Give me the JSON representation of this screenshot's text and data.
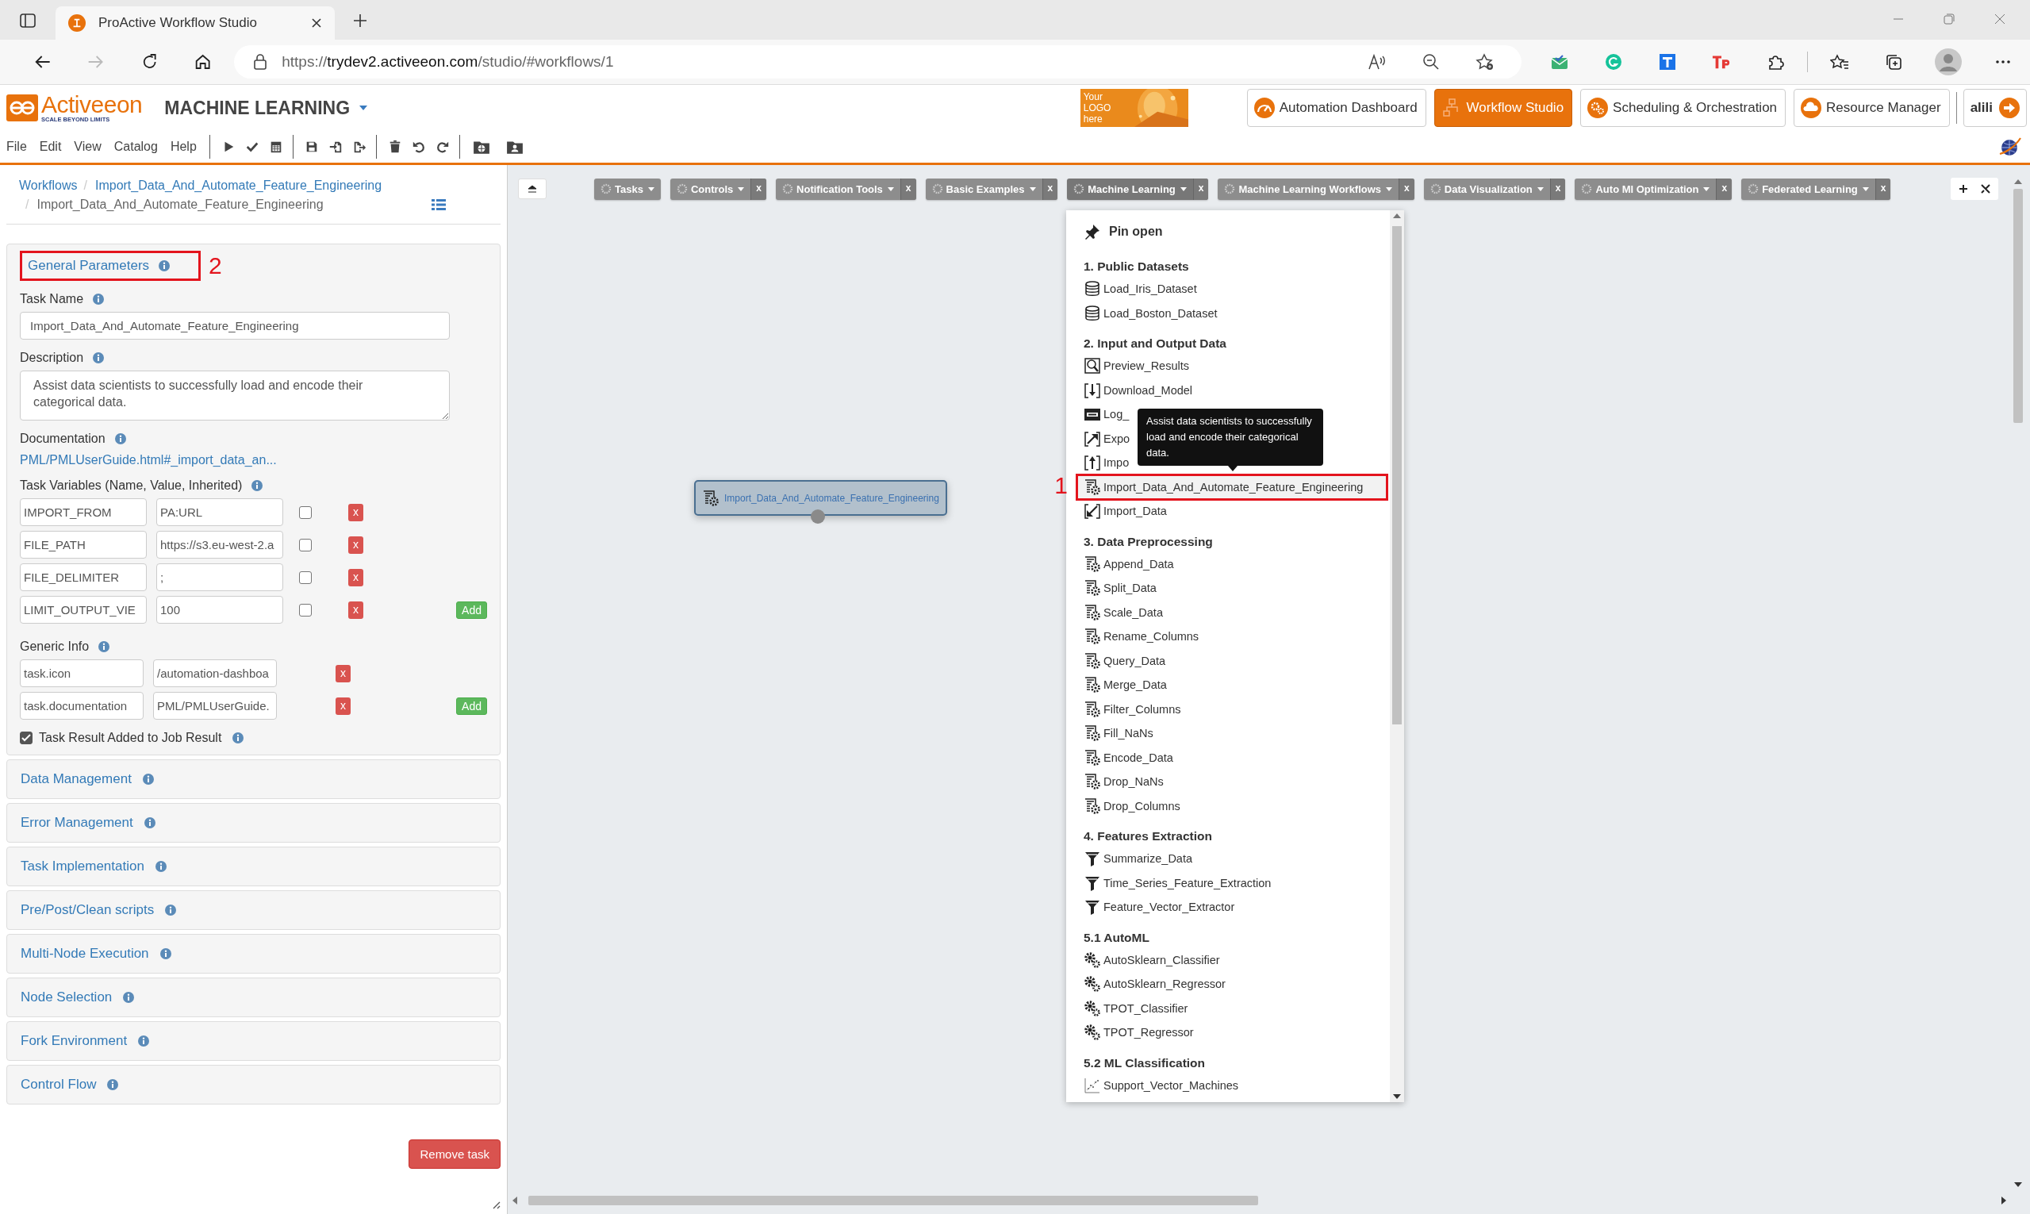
{
  "browser": {
    "tab_title": "ProActive Workflow Studio",
    "url": {
      "scheme": "https://",
      "host": "trydev2.activeeon.com",
      "path": "/studio/#workflows/1"
    }
  },
  "header": {
    "logo": "Activeeon",
    "tagline": "SCALE BEYOND LIMITS",
    "workspace": "MACHINE LEARNING",
    "logo_placeholder": "Your LOGO here",
    "portals": [
      {
        "label": "Automation Dashboard",
        "selected": false
      },
      {
        "label": "Workflow Studio",
        "selected": true
      },
      {
        "label": "Scheduling & Orchestration",
        "selected": false
      },
      {
        "label": "Resource Manager",
        "selected": false
      }
    ],
    "user": "alili"
  },
  "menu": [
    "File",
    "Edit",
    "View",
    "Catalog",
    "Help"
  ],
  "breadcrumb": [
    {
      "label": "Workflows",
      "link": true
    },
    {
      "sep": "/",
      "label": "Import_Data_And_Automate_Feature_Engineering",
      "link": true
    },
    {
      "sep": "/",
      "label": "Import_Data_And_Automate_Feature_Engineering",
      "link": false
    }
  ],
  "properties": {
    "general": {
      "title": "General Parameters",
      "callout": "2",
      "task_name_label": "Task Name",
      "task_name": "Import_Data_And_Automate_Feature_Engineering",
      "description_label": "Description",
      "description": "Assist data scientists to successfully load and encode their categorical data.",
      "documentation_label": "Documentation",
      "documentation": "PML/PMLUserGuide.html#_import_data_an...",
      "variables_label": "Task Variables (Name, Value, Inherited)",
      "variables": [
        {
          "name": "IMPORT_FROM",
          "value": "PA:URL",
          "inherited": false,
          "remove": "x"
        },
        {
          "name": "FILE_PATH",
          "value": "https://s3.eu-west-2.a",
          "inherited": false,
          "remove": "x"
        },
        {
          "name": "FILE_DELIMITER",
          "value": ";",
          "inherited": false,
          "remove": "x"
        },
        {
          "name": "LIMIT_OUTPUT_VIE",
          "value": "100",
          "inherited": false,
          "remove": "x"
        }
      ],
      "variables_add": "Add",
      "generic_info_label": "Generic Info",
      "generic_info": [
        {
          "name": "task.icon",
          "value": "/automation-dashboa",
          "remove": "x"
        },
        {
          "name": "task.documentation",
          "value": "PML/PMLUserGuide.",
          "remove": "x"
        }
      ],
      "generic_info_add": "Add",
      "result_label": "Task Result Added to Job Result",
      "result_checked": true
    },
    "sections": [
      "Data Management",
      "Error Management",
      "Task Implementation",
      "Pre/Post/Clean scripts",
      "Multi-Node Execution",
      "Node Selection",
      "Fork Environment",
      "Control Flow"
    ],
    "remove_task": "Remove task"
  },
  "palette": {
    "tabs": [
      {
        "label": "Tasks",
        "open": false
      },
      {
        "label": "Controls",
        "close": "x",
        "open": false
      },
      {
        "label": "Notification Tools",
        "close": "x",
        "open": false
      },
      {
        "label": "Basic Examples",
        "close": "x",
        "open": false
      },
      {
        "label": "Machine Learning",
        "close": "x",
        "open": true
      },
      {
        "label": "Machine Learning Workflows",
        "close": "x",
        "open": false
      },
      {
        "label": "Data Visualization",
        "close": "x",
        "open": false
      },
      {
        "label": "Auto Ml Optimization",
        "close": "x",
        "open": false
      },
      {
        "label": "Federated Learning",
        "close": "x",
        "open": false
      }
    ],
    "dropdown": {
      "pin": "Pin open",
      "entries": [
        {
          "kind": "header",
          "label": "1. Public Datasets"
        },
        {
          "kind": "dataset",
          "label": "Load_Iris_Dataset"
        },
        {
          "kind": "dataset",
          "label": "Load_Boston_Dataset"
        },
        {
          "kind": "header",
          "label": "2. Input and Output Data"
        },
        {
          "kind": "preview",
          "label": "Preview_Results"
        },
        {
          "kind": "download",
          "label": "Download_Model"
        },
        {
          "kind": "log",
          "label": "Log_"
        },
        {
          "kind": "export",
          "label": "Expo"
        },
        {
          "kind": "upload",
          "label": "Impo"
        },
        {
          "kind": "script",
          "label": "Import_Data_And_Automate_Feature_Engineering",
          "callout": "1",
          "tooltip": "Assist data scientists to successfully load and encode their categorical data."
        },
        {
          "kind": "import",
          "label": "Import_Data"
        },
        {
          "kind": "header",
          "label": "3. Data Preprocessing"
        },
        {
          "kind": "script",
          "label": "Append_Data"
        },
        {
          "kind": "script",
          "label": "Split_Data"
        },
        {
          "kind": "script",
          "label": "Scale_Data"
        },
        {
          "kind": "script",
          "label": "Rename_Columns"
        },
        {
          "kind": "script",
          "label": "Query_Data"
        },
        {
          "kind": "script",
          "label": "Merge_Data"
        },
        {
          "kind": "script",
          "label": "Filter_Columns"
        },
        {
          "kind": "script",
          "label": "Fill_NaNs"
        },
        {
          "kind": "script",
          "label": "Encode_Data"
        },
        {
          "kind": "script",
          "label": "Drop_NaNs"
        },
        {
          "kind": "script",
          "label": "Drop_Columns"
        },
        {
          "kind": "header",
          "label": "4. Features Extraction"
        },
        {
          "kind": "filter",
          "label": "Summarize_Data"
        },
        {
          "kind": "filter",
          "label": "Time_Series_Feature_Extraction"
        },
        {
          "kind": "filter",
          "label": "Feature_Vector_Extractor"
        },
        {
          "kind": "header",
          "label": "5.1 AutoML"
        },
        {
          "kind": "gears",
          "label": "AutoSklearn_Classifier"
        },
        {
          "kind": "gears",
          "label": "AutoSklearn_Regressor"
        },
        {
          "kind": "gears",
          "label": "TPOT_Classifier"
        },
        {
          "kind": "gears",
          "label": "TPOT_Regressor"
        },
        {
          "kind": "header",
          "label": "5.2 ML Classification"
        },
        {
          "kind": "scatter",
          "label": "Support_Vector_Machines"
        }
      ]
    }
  },
  "canvas": {
    "task": {
      "label": "Import_Data_And_Automate_Feature_Engineering"
    }
  }
}
